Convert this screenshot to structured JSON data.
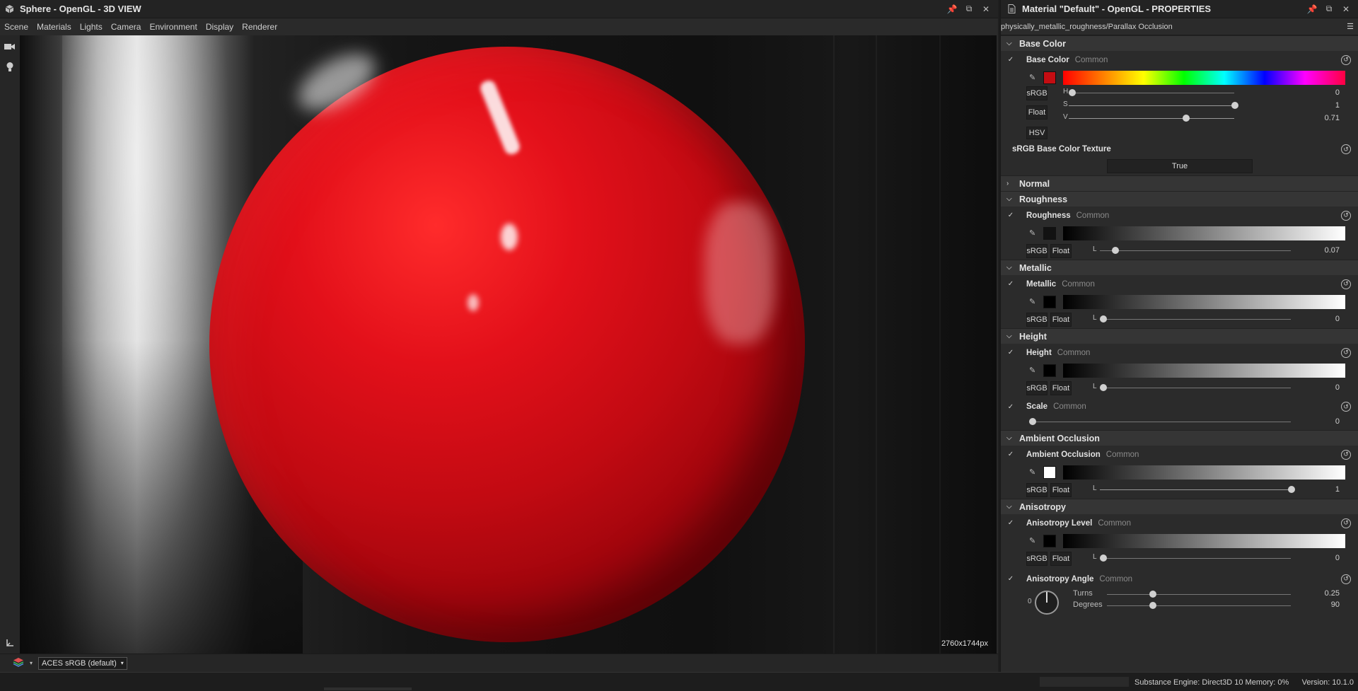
{
  "view": {
    "title": "Sphere - OpenGL - 3D VIEW",
    "menu": [
      "Scene",
      "Materials",
      "Lights",
      "Camera",
      "Environment",
      "Display",
      "Renderer"
    ],
    "resolution": "2760x1744px",
    "colorspace": "ACES sRGB (default)"
  },
  "props": {
    "title": "Material \"Default\" - OpenGL - PROPERTIES",
    "path": "physically_metallic_roughness/Parallax Occlusion",
    "common": "Common",
    "srgb": "sRGB",
    "float": "Float",
    "hsv": "HSV",
    "base_color": {
      "section": "Base Color",
      "name": "Base Color",
      "swatch": "#c40d12",
      "h_label": "H",
      "h_value": "0",
      "s_label": "S",
      "s_value": "1",
      "v_label": "V",
      "v_value": "0.71"
    },
    "texture": {
      "label": "sRGB Base Color Texture",
      "value": "True"
    },
    "normal": {
      "section": "Normal"
    },
    "roughness": {
      "section": "Roughness",
      "name": "Roughness",
      "l_label": "L",
      "value": "0.07"
    },
    "metallic": {
      "section": "Metallic",
      "name": "Metallic",
      "l_label": "L",
      "value": "0"
    },
    "height": {
      "section": "Height",
      "name": "Height",
      "l_label": "L",
      "value": "0",
      "scale_name": "Scale",
      "scale_value": "0"
    },
    "ao": {
      "section": "Ambient Occlusion",
      "name": "Ambient Occlusion",
      "l_label": "L",
      "value": "1"
    },
    "aniso": {
      "section": "Anisotropy",
      "name": "Anisotropy Level",
      "l_label": "L",
      "value": "0",
      "angle_name": "Anisotropy Angle",
      "dial_value": "0",
      "turns_label": "Turns",
      "turns_value": "0.25",
      "degrees_label": "Degrees",
      "degrees_value": "90"
    }
  },
  "status": {
    "engine": "Substance Engine: Direct3D 10  Memory: 0%",
    "version": "Version: 10.1.0"
  }
}
